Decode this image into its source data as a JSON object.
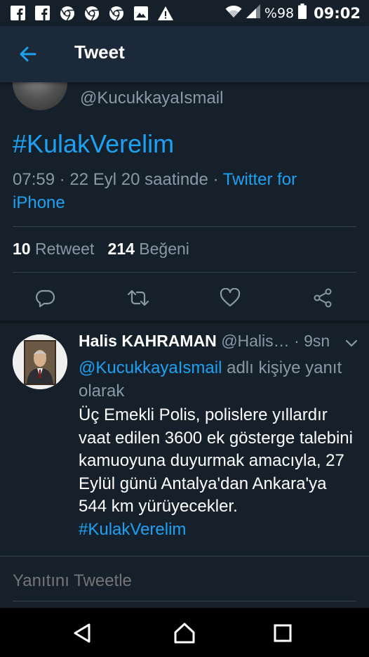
{
  "status_bar": {
    "battery_percent": "%98",
    "time": "09:02",
    "icons": [
      "facebook-icon",
      "facebook-icon",
      "chrome-icon",
      "chrome-icon",
      "chrome-icon",
      "image-icon",
      "warning-icon",
      "wifi-icon",
      "signal-icon",
      "battery-icon"
    ]
  },
  "app_bar": {
    "title": "Tweet",
    "back_icon": "arrow-left-icon"
  },
  "main_tweet": {
    "handle": "@KucukkayaIsmail",
    "text": "#KulakVerelim",
    "time": "07:59",
    "date": "22 Eyl 20 saatinde",
    "source": "Twitter for iPhone",
    "retweet_count": "10",
    "retweet_label": "Retweet",
    "like_count": "214",
    "like_label": "Beğeni"
  },
  "reply_tweet": {
    "name": "Halis KAHRAMAN",
    "handle": "@Halis…",
    "time": "· 9sn",
    "mention": "@KucukkayaIsmail",
    "reply_to_suffix": "adlı kişiye yanıt olarak",
    "body": "Üç Emekli Polis, polislere yıllardır vaat edilen 3600 ek gösterge talebini kamuoyuna duyurmak amacıyla, 27 Eylül günü Antalya'dan Ankara'ya 544 km yürüyecekler.",
    "hashtag": "#KulakVerelim"
  },
  "compose": {
    "placeholder": "Yanıtını Tweetle"
  },
  "colors": {
    "background": "#15202b",
    "app_bar": "#1c2938",
    "accent": "#1da1f2",
    "secondary_text": "#8899a6",
    "divider": "#38444d"
  }
}
